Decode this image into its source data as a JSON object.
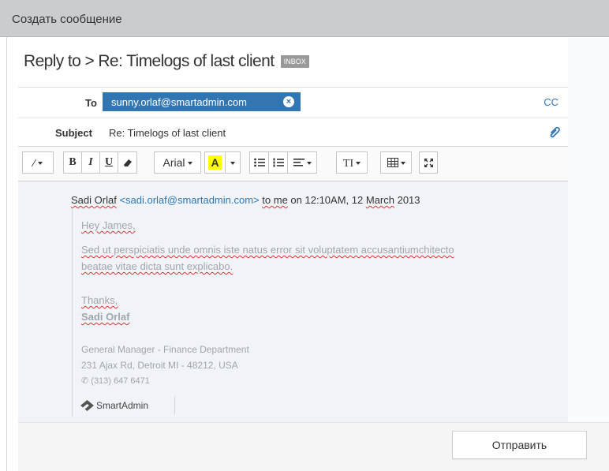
{
  "window": {
    "title": "Создать сообщение"
  },
  "compose": {
    "reply_title": "Reply to > Re: Timelogs of last client",
    "badge": "INBOX",
    "to_label": "To",
    "to_recipient": "sunny.orlaf@smartadmin.com",
    "cc_label": "CC",
    "subject_label": "Subject",
    "subject_value": "Re: Timelogs of last client"
  },
  "toolbar": {
    "font_name": "Arial",
    "bold": "B",
    "italic": "I",
    "underline": "U",
    "highlight": "A",
    "text_size": "TI"
  },
  "message": {
    "sender_name": "Sadi Orlaf",
    "sender_email": "<sadi.orlaf@smartadmin.com>",
    "to_me": "to me",
    "on_text": "on 12:10AM, 12",
    "month": "March",
    "year": "2013",
    "greeting": "Hey James,",
    "body_line1": "Sed ut perspiciatis unde omnis iste natus error sit voluptatem accusantiumchitecto",
    "body_line2": "beatae vitae dicta sunt explicabo.",
    "closing": "Thanks,",
    "signature_name": "Sadi Orlaf",
    "signature_title": "General Manager - Finance Department",
    "signature_address": "231 Ajax Rd, Detroit MI - 48212, USA",
    "signature_phone": "(313) 647 6471",
    "logo_text": "SmartAdmin"
  },
  "footer": {
    "send_label": "Отправить"
  },
  "colors": {
    "accent": "#3276b1",
    "header_bg": "#c9cdd0",
    "panel_bg": "#f0f4f8",
    "highlight": "#ffff00"
  }
}
